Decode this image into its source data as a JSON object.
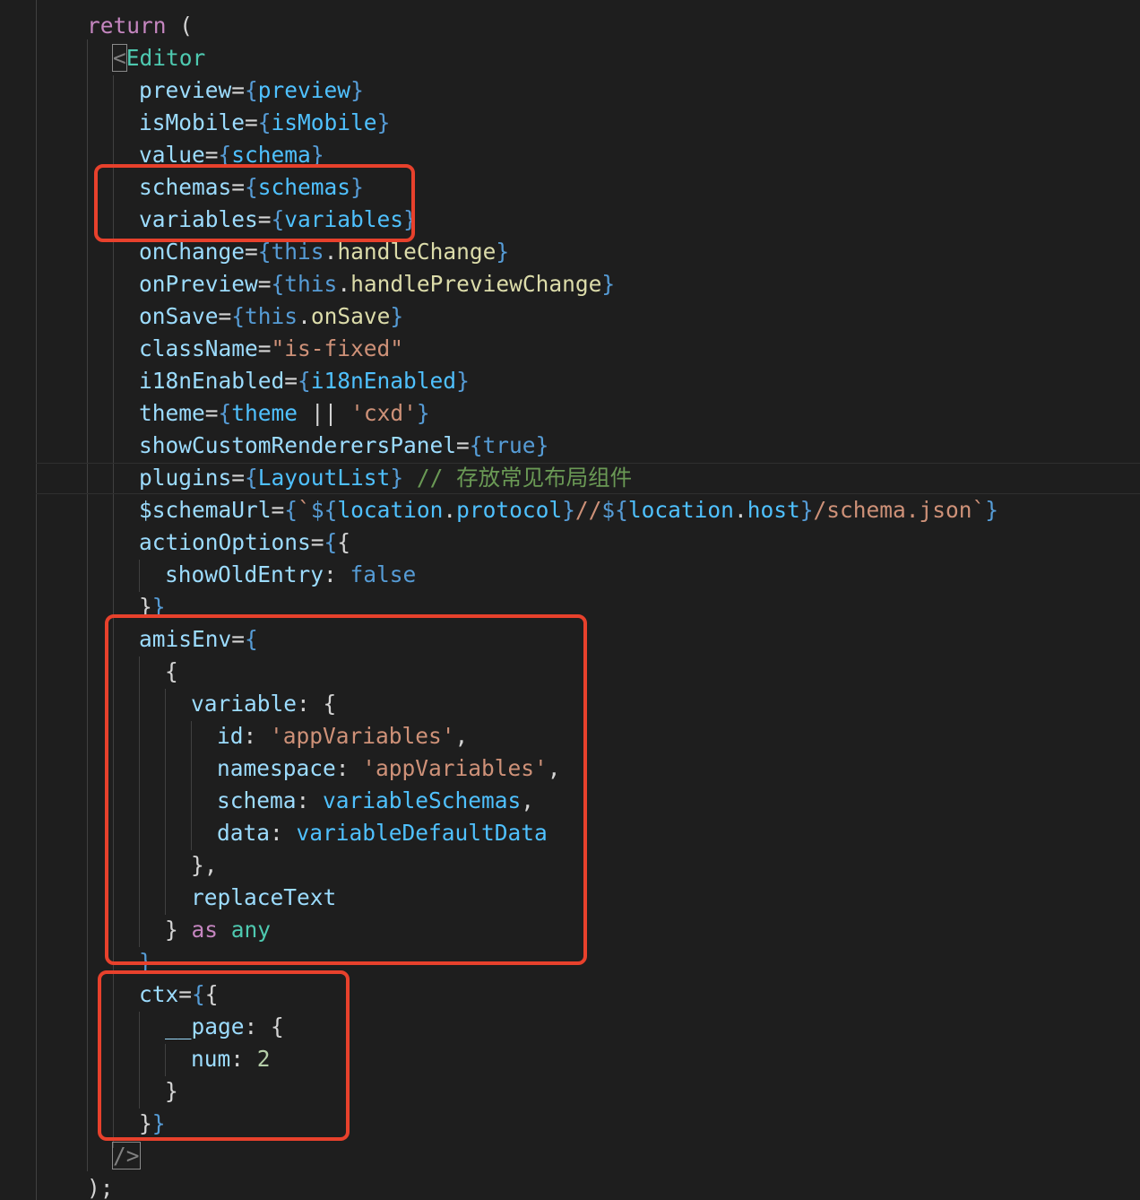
{
  "colors": {
    "background": "#1e1e1e",
    "highlight_box": "#e8412c"
  },
  "code": {
    "return_kw": "return",
    "return_paren": "(",
    "editor_open": "Editor",
    "props": {
      "preview": {
        "name": "preview",
        "value": "preview"
      },
      "isMobile": {
        "name": "isMobile",
        "value": "isMobile"
      },
      "value": {
        "name": "value",
        "value": "schema"
      },
      "schemas": {
        "name": "schemas",
        "value": "schemas"
      },
      "variables": {
        "name": "variables",
        "value": "variables"
      },
      "onChange": {
        "name": "onChange",
        "this": "this",
        "fn": "handleChange"
      },
      "onPreview": {
        "name": "onPreview",
        "this": "this",
        "fn": "handlePreviewChange"
      },
      "onSave": {
        "name": "onSave",
        "this": "this",
        "fn": "onSave"
      },
      "className": {
        "name": "className",
        "value": "\"is-fixed\""
      },
      "i18nEnabled": {
        "name": "i18nEnabled",
        "value": "i18nEnabled"
      },
      "theme": {
        "name": "theme",
        "ident": "theme",
        "op": "||",
        "fallback": "'cxd'"
      },
      "showCustomRenderersPanel": {
        "name": "showCustomRenderersPanel",
        "value": "true"
      },
      "plugins": {
        "name": "plugins",
        "value": "LayoutList",
        "comment": "// 存放常见布局组件"
      },
      "schemaUrl": {
        "name": "$schemaUrl",
        "tick": "`",
        "interp_open": "${",
        "interp_close": "}",
        "obj1": "location",
        "prop1": "protocol",
        "sep": "//",
        "obj2": "location",
        "prop2": "host",
        "tail": "/schema.json"
      },
      "actionOptions": {
        "name": "actionOptions",
        "key": "showOldEntry",
        "value": "false"
      },
      "amisEnv": {
        "name": "amisEnv",
        "variable_key": "variable",
        "id_key": "id",
        "id_value": "'appVariables'",
        "namespace_key": "namespace",
        "namespace_value": "'appVariables'",
        "schema_key": "schema",
        "schema_value": "variableSchemas",
        "data_key": "data",
        "data_value": "variableDefaultData",
        "replace_text": "replaceText",
        "as_kw": "as",
        "any_type": "any"
      },
      "ctx": {
        "name": "ctx",
        "page_key": "__page",
        "num_key": "num",
        "num_value": "2"
      }
    },
    "close_tag": "/>",
    "close_paren": ");"
  }
}
